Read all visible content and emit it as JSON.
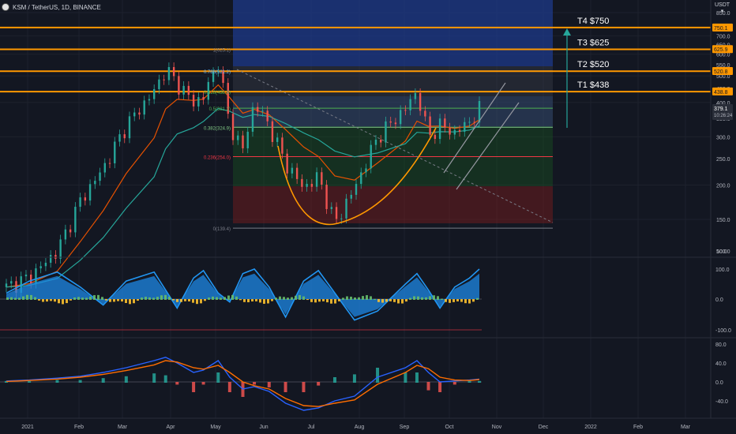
{
  "header": {
    "symbol": "KSM / TetherUS, 1D, BINANCE"
  },
  "currency": {
    "line1": "USDT",
    "line2": "▾"
  },
  "colors": {
    "background": "#131722",
    "up": "#26a69a",
    "down": "#ef5350",
    "target": "#ff9800",
    "ma_fast": "#e65100",
    "ma_slow": "#26a69a",
    "zone_blue": "#1e3a8a",
    "macd": "#2962ff",
    "signal": "#ff6d00",
    "rsi": "#2196f3"
  },
  "x_axis": {
    "labels": [
      "2021",
      "Feb",
      "Mar",
      "Apr",
      "May",
      "Jun",
      "Jul",
      "Aug",
      "Sep",
      "Oct",
      "Nov",
      "Dec",
      "2022",
      "Feb",
      "Mar"
    ]
  },
  "price_axis": {
    "labels": [
      "850.0",
      "700.0",
      "650.0",
      "600.0",
      "550.0",
      "500.0",
      "450.0",
      "400.0",
      "350.0",
      "300.0",
      "250.0",
      "200.0",
      "150.0",
      "100.0",
      "50.0"
    ]
  },
  "price_tags": {
    "t4": "750.1",
    "t3": "625.9",
    "t2": "520.8",
    "t1": "438.8",
    "last_price": "379.1",
    "last_time": "10:26:24"
  },
  "targets": [
    {
      "label": "T4 $750",
      "price": 750
    },
    {
      "label": "T3 $625",
      "price": 625
    },
    {
      "label": "T2 $520",
      "price": 520
    },
    {
      "label": "T1 $438",
      "price": 438
    }
  ],
  "fib": {
    "levels": [
      {
        "label": "1(625.1)",
        "price": 625.1,
        "color": "#787b86"
      },
      {
        "label": "0.786(521.2)",
        "price": 521.2,
        "color": "#64b5f6"
      },
      {
        "label": "0.618(438.8)",
        "price": 438.8,
        "color": "#4caf50"
      },
      {
        "label": "0.5(381.2)",
        "price": 381.2,
        "color": "#4caf50"
      },
      {
        "label": "0.382(324.9)",
        "price": 324.9,
        "color": "#81c784"
      },
      {
        "label": "0.236(254.0)",
        "price": 254.0,
        "color": "#f23645"
      },
      {
        "label": "0(139.4)",
        "price": 139.4,
        "color": "#787b86"
      }
    ]
  },
  "oscillator_axis": {
    "labels": [
      "100.0",
      "0.0",
      "-100.0"
    ]
  },
  "macd_axis": {
    "labels": [
      "80.0",
      "40.0",
      "0.0",
      "-40.0"
    ]
  },
  "chart_data": {
    "type": "candlestick",
    "title": "KSM / TetherUS, 1D, BINANCE",
    "price_unit": "USDT",
    "y_scale": "log",
    "price_series": {
      "dates": [
        "2021-01-01",
        "2021-01-15",
        "2021-02-01",
        "2021-02-15",
        "2021-03-01",
        "2021-03-15",
        "2021-04-01",
        "2021-04-08",
        "2021-04-15",
        "2021-04-25",
        "2021-05-01",
        "2021-05-10",
        "2021-05-17",
        "2021-05-25",
        "2021-06-01",
        "2021-06-10",
        "2021-06-20",
        "2021-07-01",
        "2021-07-10",
        "2021-07-20",
        "2021-08-01",
        "2021-08-15",
        "2021-09-01",
        "2021-09-08",
        "2021-09-15",
        "2021-09-22",
        "2021-10-01",
        "2021-10-10",
        "2021-10-16"
      ],
      "close": [
        85,
        92,
        115,
        175,
        230,
        330,
        440,
        530,
        470,
        400,
        420,
        560,
        330,
        270,
        400,
        330,
        240,
        195,
        215,
        145,
        195,
        300,
        380,
        440,
        300,
        330,
        310,
        340,
        379
      ]
    },
    "price_ylim": [
      40,
      900
    ],
    "oscillator": {
      "name": "",
      "values": [
        20,
        60,
        90,
        40,
        -20,
        60,
        90,
        30,
        -30,
        70,
        95,
        20,
        -10,
        85,
        100,
        40,
        -60,
        60,
        95,
        20,
        -70,
        -40,
        50,
        85,
        30,
        -30,
        40,
        70,
        100
      ],
      "ylim": [
        -110,
        110
      ]
    },
    "macd": {
      "macd": [
        2,
        4,
        8,
        12,
        20,
        30,
        45,
        52,
        40,
        20,
        25,
        45,
        10,
        -15,
        -10,
        -20,
        -45,
        -60,
        -55,
        -40,
        -30,
        10,
        30,
        45,
        20,
        0,
        2,
        4,
        6
      ],
      "signal": [
        1,
        3,
        6,
        10,
        16,
        24,
        36,
        45,
        42,
        30,
        27,
        35,
        20,
        0,
        -8,
        -15,
        -35,
        -50,
        -52,
        -45,
        -38,
        -5,
        20,
        35,
        28,
        10,
        4,
        3,
        5
      ],
      "ylim": [
        -60,
        90
      ]
    }
  }
}
